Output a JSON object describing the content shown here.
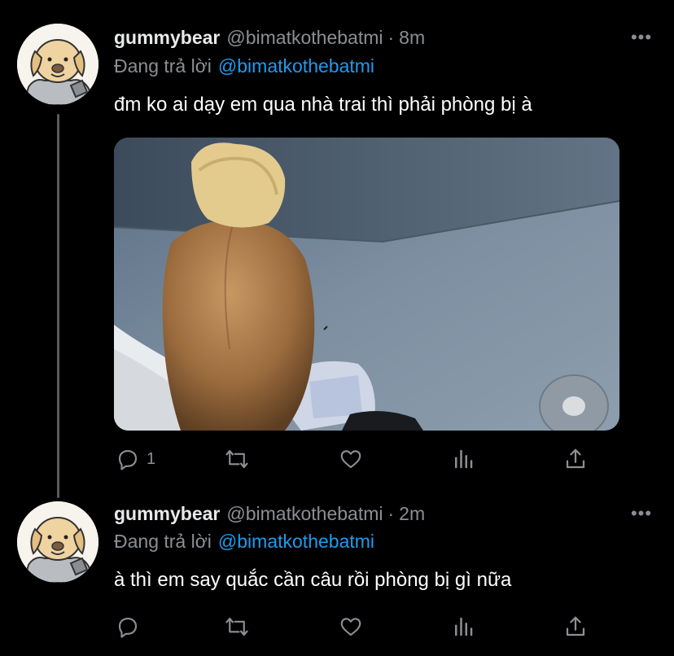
{
  "tweets": [
    {
      "display_name": "gummybear",
      "handle": "@bimatkothebatmi",
      "separator": "·",
      "time": "8m",
      "reply_prefix": "Đang trả lời",
      "reply_to": "@bimatkothebatmi",
      "text": "đm ko ai dạy em qua nhà trai thì phải phòng bị à",
      "more_icon": "•••",
      "actions": {
        "reply_count": "1",
        "retweet_count": "",
        "like_count": ""
      }
    },
    {
      "display_name": "gummybear",
      "handle": "@bimatkothebatmi",
      "separator": "·",
      "time": "2m",
      "reply_prefix": "Đang trả lời",
      "reply_to": "@bimatkothebatmi",
      "text": "à thì em say quắc cần câu rồi phòng bị gì nữa",
      "more_icon": "•••",
      "actions": {
        "reply_count": "",
        "retweet_count": "",
        "like_count": ""
      }
    }
  ],
  "icons": [
    "reply-icon",
    "retweet-icon",
    "like-icon",
    "analytics-icon",
    "share-icon",
    "more-icon"
  ],
  "colors": {
    "background": "#000000",
    "text": "#e7e9ea",
    "muted": "#8b8f94",
    "link": "#1d9bf0",
    "thread_line": "#5a5a5a"
  }
}
